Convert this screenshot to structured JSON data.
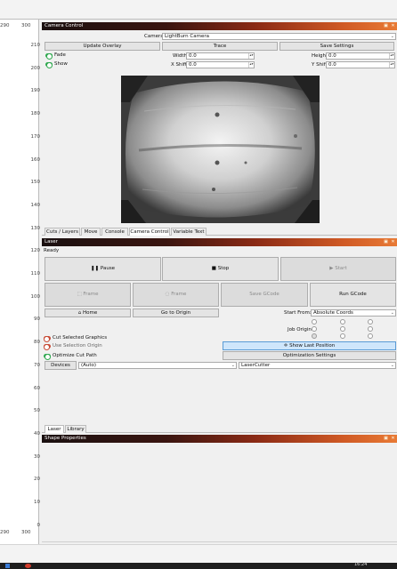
{
  "canvas": {
    "ruler_top": [
      "290",
      "300"
    ],
    "ruler_bottom": [
      "290",
      "300"
    ],
    "v_ticks": [
      "210",
      "200",
      "190",
      "180",
      "170",
      "160",
      "150",
      "140",
      "130",
      "120",
      "110",
      "100",
      "90",
      "80",
      "70",
      "60",
      "50",
      "40",
      "30",
      "20",
      "10",
      "0"
    ]
  },
  "camera_control": {
    "title": "Camera Control",
    "camera_label": "Camera:",
    "camera_value": "LightBurn Camera",
    "update_overlay": "Update Overlay",
    "trace": "Trace",
    "save_settings": "Save Settings",
    "fade_label": "Fade",
    "show_label": "Show",
    "width_label": "Width",
    "width_value": "0.0",
    "height_label": "Height",
    "height_value": "0.0",
    "xshift_label": "X Shift",
    "xshift_value": "0.0",
    "yshift_label": "Y Shift",
    "yshift_value": "0.0"
  },
  "tabs_top": [
    {
      "label": "Cuts / Layers"
    },
    {
      "label": "Move"
    },
    {
      "label": "Console"
    },
    {
      "label": "Camera Control"
    },
    {
      "label": "Variable Text"
    }
  ],
  "laser": {
    "title": "Laser",
    "status": "Ready",
    "pause": "Pause",
    "stop": "Stop",
    "start": "Start",
    "frame1": "Frame",
    "frame2": "Frame",
    "save_gcode": "Save GCode",
    "run_gcode": "Run GCode",
    "home": "Home",
    "go_to_origin": "Go to Origin",
    "start_from_label": "Start From:",
    "start_from_value": "Absolute Coords",
    "job_origin_label": "Job Origin",
    "cut_selected": "Cut Selected Graphics",
    "use_selection_origin": "Use Selection Origin",
    "optimize_cut_path": "Optimize Cut Path",
    "show_last_position": "Show Last Position",
    "optimization_settings": "Optimization Settings",
    "devices": "Devices",
    "port_value": "(Auto)",
    "device_value": "LaserCutter"
  },
  "tabs_bottom": [
    {
      "label": "Laser"
    },
    {
      "label": "Library"
    }
  ],
  "shape_properties": {
    "title": "Shape Properties"
  },
  "taskbar": {
    "clock": "16:24"
  },
  "colors": {
    "accent_green": "#2fa84f",
    "accent_red": "#c84a35",
    "highlight_blue": "#cfe6fb"
  }
}
